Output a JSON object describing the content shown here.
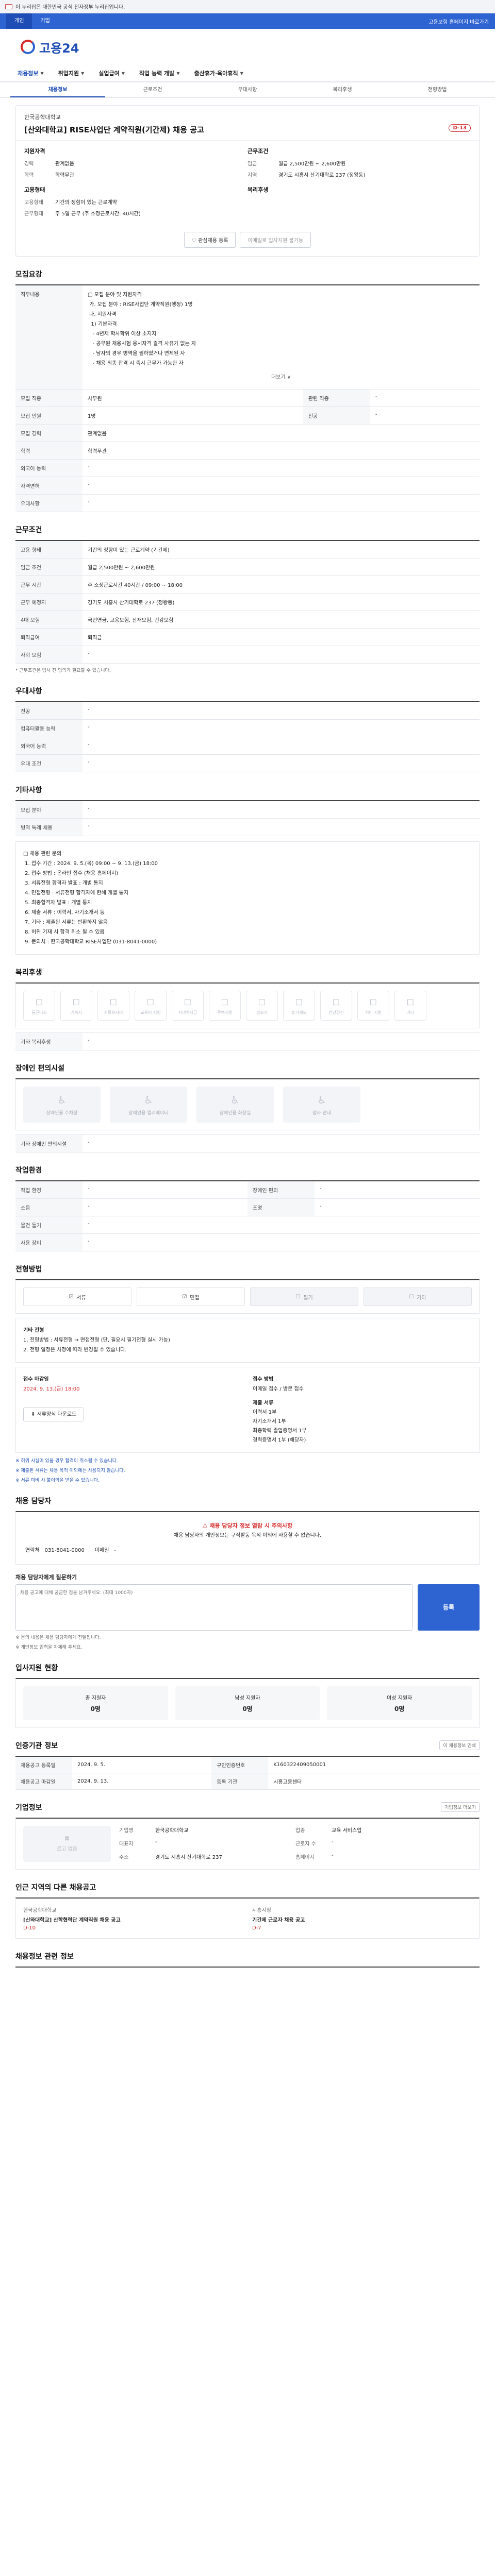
{
  "gov_bar": {
    "text": "이 누리집은 대한민국 공식 전자정부 누리집입니다."
  },
  "top_bar": {
    "tabs": [
      "개인",
      "기업"
    ],
    "right_text": "고용보험 홈페이지 바로가기"
  },
  "logo": {
    "text": "고용24"
  },
  "gnb": {
    "items": [
      "채용정보",
      "취업지원",
      "실업급여",
      "직업 능력 개발",
      "출산휴가·육아휴직"
    ]
  },
  "subtabs": [
    "채용정보",
    "근로조건",
    "우대사항",
    "복리후생",
    "전형방법"
  ],
  "summary": {
    "company": "한국공학대학교",
    "title": "[산와대학교] RISE사업단 계약직원(기간제) 채용 공고",
    "dday": "D-13",
    "recruit_title": "지원자격",
    "recruit_items": [
      {
        "k": "경력",
        "v": "관계없음"
      },
      {
        "k": "학력",
        "v": "학력무관"
      }
    ],
    "work_title": "근무조건",
    "work_items": [
      {
        "k": "임금",
        "v": "월급 2,500만원 ~ 2,600만원"
      },
      {
        "k": "지역",
        "v": "경기도 시흥시 산기대학로 237 (정왕동)"
      }
    ],
    "employ_title": "고용형태",
    "employ_items": [
      {
        "k": "고용형태",
        "v": "기간의 정함이 있는 근로계약"
      },
      {
        "k": "근무형태",
        "v": "주 5일 근무 (주 소정근로시간: 40시간)"
      }
    ],
    "welfare_title": "복리후생",
    "btn_interest": "관심채용 등록",
    "btn_apply": "이메일로 입사지원 불가능"
  },
  "recruit_section": {
    "title": "모집요강",
    "duty_label": "직무내용",
    "duty_lines": [
      "□ 모집 분야 및 지원자격",
      " 가. 모집 분야 : RISE사업단 계약직원(행정) 1명",
      "",
      " 나. 지원자격",
      "  1) 기본자격",
      "   - 4년제 학사학위 이상 소지자",
      "   - 공무원 채용시험 응시자격 결격 사유가 없는 자",
      "   - 남자의 경우 병역을 필하였거나 면제된 자",
      "   - 채용 최종 합격 시 즉시 근무가 가능한 자"
    ],
    "more": "더보기 ∨",
    "rows": [
      {
        "k": "모집 직종",
        "v": "사무원",
        "k2": "관련 직종",
        "v2": "-"
      },
      {
        "k": "모집 인원",
        "v": "1명",
        "k2": "전공",
        "v2": "-"
      },
      {
        "k": "모집 경력",
        "v": "관계없음",
        "k2": "",
        "v2": ""
      },
      {
        "k": "학력",
        "v": "학력무관",
        "k2": "",
        "v2": ""
      },
      {
        "k": "외국어 능력",
        "v": "-",
        "k2": "",
        "v2": ""
      },
      {
        "k": "자격면허",
        "v": "-",
        "k2": "",
        "v2": ""
      },
      {
        "k": "우대사항",
        "v": "-",
        "k2": "",
        "v2": ""
      }
    ]
  },
  "work_section": {
    "title": "근무조건",
    "rows": [
      {
        "k": "고용 형태",
        "v": "기간의 정함이 있는 근로계약 (기간제)"
      },
      {
        "k": "임금 조건",
        "v": "월급 2,500만원 ~ 2,600만원"
      },
      {
        "k": "근무 시간",
        "v": "주 소정근로시간 40시간 / 09:00 ~ 18:00"
      },
      {
        "k": "근무 예정지",
        "v": "경기도 시흥시 산기대학로 237 (정왕동)"
      },
      {
        "k": "4대 보험",
        "v": "국민연금, 고용보험, 산재보험, 건강보험"
      },
      {
        "k": "퇴직급여",
        "v": "퇴직금"
      },
      {
        "k": "사회 보험",
        "v": "-"
      }
    ],
    "map_btn": "지도 보기",
    "note": "* 근무조건은 입사 전 협의가 필요할 수 있습니다."
  },
  "pref_section": {
    "title": "우대사항",
    "rows": [
      {
        "k": "전공",
        "v": "-"
      },
      {
        "k": "컴퓨터활용 능력",
        "v": "-"
      },
      {
        "k": "외국어 능력",
        "v": "-"
      },
      {
        "k": "우대 조건",
        "v": "-"
      }
    ]
  },
  "other_section": {
    "title": "기타사항",
    "rows": [
      {
        "k": "모집 분야",
        "v": "-"
      },
      {
        "k": "병역 특례 채용",
        "v": "-"
      }
    ],
    "list_lines": [
      "□ 채용 관련 문의",
      " 1. 접수 기간 : 2024. 9. 5.(목) 09:00 ~ 9. 13.(금) 18:00",
      " 2. 접수 방법 : 온라인 접수 (채용 홈페이지)",
      " 3. 서류전형 합격자 발표 : 개별 통지",
      " 4. 면접전형 : 서류전형 합격자에 한해 개별 통지",
      " 5. 최종합격자 발표 : 개별 통지",
      " 6. 제출 서류 : 이력서, 자기소개서 등",
      " 7. 기타 : 제출된 서류는 반환하지 않음",
      " 8. 허위 기재 시 합격 취소 될 수 있음",
      " 9. 문의처 : 한국공학대학교 RISE사업단 (031-8041-0000)"
    ]
  },
  "welfare_section": {
    "title": "복리후생",
    "tiles": [
      "통근버스",
      "기숙사",
      "차량유지비",
      "교육비 지원",
      "자녀학자금",
      "주택지원",
      "경조사",
      "휴가제도",
      "건강검진",
      "식비 지원",
      "기타"
    ],
    "other_label": "기타 복리후생",
    "other_value": "-"
  },
  "disability_section": {
    "title": "장애인 편의시설",
    "tiles": [
      "장애인용 주차장",
      "장애인용 엘리베이터",
      "장애인용 화장실",
      "점자 안내"
    ],
    "note_label": "기타 장애인 편의시설",
    "note_value": "-"
  },
  "workenv_section": {
    "title": "작업환경",
    "rows": [
      {
        "k": "작업 환경",
        "v": "-",
        "k2": "장애인 편의",
        "v2": "-"
      },
      {
        "k": "소음",
        "v": "-",
        "k2": "조명",
        "v2": "-"
      },
      {
        "k": "물건 들기",
        "v": "-",
        "k2": "",
        "v2": ""
      },
      {
        "k": "사용 장비",
        "v": "-",
        "k2": "",
        "v2": ""
      }
    ]
  },
  "process_section": {
    "title": "전형방법",
    "methods": [
      "서류",
      "면접",
      "필기",
      "기타"
    ],
    "detail_label": "기타 전형",
    "detail_lines": [
      "1. 전형방법 : 서류전형 → 면접전형 (단, 필요시 필기전형 실시 가능)",
      "2. 전형 일정은 사정에 따라 변경될 수 있습니다."
    ],
    "deadline_label": "접수 마감일",
    "deadline": "2024. 9. 13.(금) 18:00",
    "apply_label": "접수 방법",
    "apply_value": "이메일 접수 / 방문 접수",
    "docs_label": "제출 서류",
    "docs_lines": [
      "이력서 1부",
      "자기소개서 1부",
      "최종학력 졸업증명서 1부",
      "경력증명서 1부 (해당자)"
    ],
    "download_btn": "서류양식 다운로드",
    "notes": [
      "※ 허위 사실이 있을 경우 합격이 취소될 수 있습니다.",
      "※ 제출된 서류는 채용 목적 이외에는 사용되지 않습니다.",
      "※ 서류 미비 시 불이익을 받을 수 있습니다."
    ]
  },
  "contact_section": {
    "title": "채용 담당자",
    "alert": "채용 담당자 정보 열람 시 주의사항",
    "body": "채용 담당자의 개인정보는 구직활동 목적 이외에 사용할 수 없습니다.",
    "label": "연락처",
    "phone": "031-8041-0000",
    "email_label": "이메일",
    "email": "-",
    "inquiry_label": "채용 담당자에게 질문하기",
    "inquiry_placeholder": "채용 공고에 대해 궁금한 점을 남겨주세요. (최대 1000자)",
    "submit": "등록",
    "notes": [
      "※ 문의 내용은 채용 담당자에게 전달됩니다.",
      "※ 개인정보 입력을 자제해 주세요."
    ]
  },
  "status_section": {
    "title": "입사지원 현황",
    "cells": [
      {
        "label": "총 지원자",
        "value": "0명"
      },
      {
        "label": "남성 지원자",
        "value": "0명"
      },
      {
        "label": "여성 지원자",
        "value": "0명"
      }
    ]
  },
  "info_section": {
    "title": "인증기관 정보",
    "rows": [
      {
        "k": "채용공고 등록일",
        "v": "2024. 9. 5.",
        "k2": "구인인증번호",
        "v2": "K160322409050001"
      },
      {
        "k": "채용공고 마감일",
        "v": "2024. 9. 13.",
        "k2": "등록 기관",
        "v2": "시흥고용센터"
      }
    ],
    "btn": "이 채용정보 인쇄"
  },
  "company_section": {
    "title": "기업정보",
    "logo_alt": "로고 없음",
    "kv": [
      {
        "k": "기업명",
        "v": "한국공학대학교"
      },
      {
        "k": "업종",
        "v": "교육 서비스업"
      },
      {
        "k": "대표자",
        "v": "-"
      },
      {
        "k": "근로자 수",
        "v": "-"
      },
      {
        "k": "주소",
        "v": "경기도 시흥시 산기대학로 237"
      },
      {
        "k": "홈페이지",
        "v": "-"
      }
    ],
    "btn": "기업정보 더보기"
  },
  "other_jobs": {
    "title": "인근 지역의 다른 채용공고",
    "items": [
      {
        "company": "한국공학대학교",
        "title": "[산와대학교] 산학협력단 계약직원 채용 공고",
        "date": "D-10"
      },
      {
        "company": "시흥시청",
        "title": "기간제 근로자 채용 공고",
        "date": "D-7"
      }
    ]
  },
  "recommend": {
    "title": "채용정보 관련 정보"
  }
}
